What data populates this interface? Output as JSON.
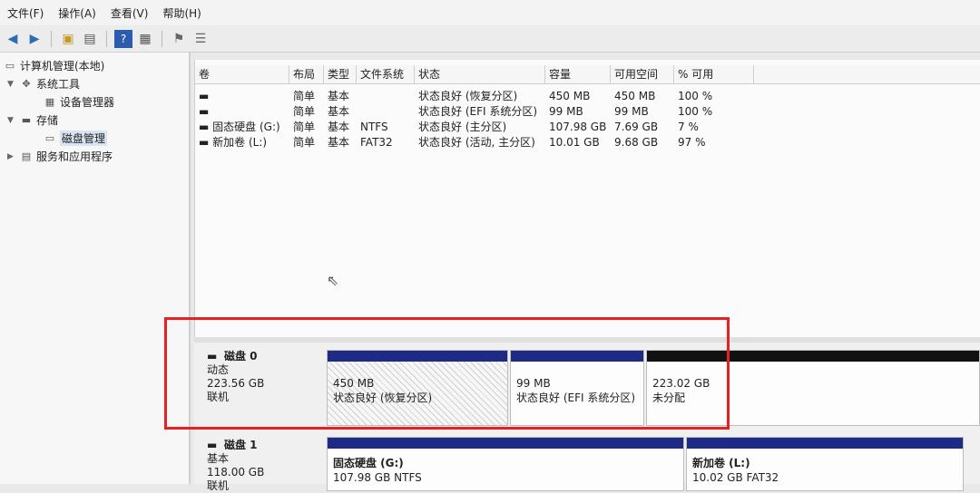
{
  "menubar": {
    "items": [
      "文件(F)",
      "操作(A)",
      "查看(V)",
      "帮助(H)"
    ]
  },
  "toolbar": {
    "icons": [
      "back-arrow-icon",
      "forward-arrow-icon",
      "up-folder-icon",
      "console-tree-icon",
      "help-icon",
      "properties-icon",
      "flag-icon",
      "list-view-icon"
    ]
  },
  "tree": {
    "root": "计算机管理(本地)",
    "system_tools": "系统工具",
    "device_manager": "设备管理器",
    "storage": "存储",
    "disk_management": "磁盘管理",
    "services": "服务和应用程序"
  },
  "volumes": {
    "columns": [
      "卷",
      "布局",
      "类型",
      "文件系统",
      "状态",
      "容量",
      "可用空间",
      "% 可用"
    ],
    "rows": [
      {
        "name": "",
        "layout": "简单",
        "type": "基本",
        "fs": "",
        "status": "状态良好 (恢复分区)",
        "capacity": "450 MB",
        "free": "450 MB",
        "pct": "100 %"
      },
      {
        "name": "",
        "layout": "简单",
        "type": "基本",
        "fs": "",
        "status": "状态良好 (EFI 系统分区)",
        "capacity": "99 MB",
        "free": "99 MB",
        "pct": "100 %"
      },
      {
        "name": "固态硬盘 (G:)",
        "layout": "简单",
        "type": "基本",
        "fs": "NTFS",
        "status": "状态良好 (主分区)",
        "capacity": "107.98 GB",
        "free": "7.69 GB",
        "pct": "7 %"
      },
      {
        "name": "新加卷 (L:)",
        "layout": "简单",
        "type": "基本",
        "fs": "FAT32",
        "status": "状态良好 (活动, 主分区)",
        "capacity": "10.01 GB",
        "free": "9.68 GB",
        "pct": "97 %"
      }
    ]
  },
  "disks": [
    {
      "name": "磁盘 0",
      "kind": "动态",
      "size": "223.56 GB",
      "state": "联机",
      "partitions": [
        {
          "title": "",
          "size": "450 MB",
          "status": "状态良好 (恢复分区)"
        },
        {
          "title": "",
          "size": "99 MB",
          "status": "状态良好 (EFI 系统分区)"
        },
        {
          "title": "",
          "size": "223.02 GB",
          "status": "未分配"
        }
      ]
    },
    {
      "name": "磁盘 1",
      "kind": "基本",
      "size": "118.00 GB",
      "state": "联机",
      "partitions": [
        {
          "title": "固态硬盘 (G:)",
          "size": "107.98 GB NTFS",
          "status": ""
        },
        {
          "title": "新加卷 (L:)",
          "size": "10.02 GB FAT32",
          "status": ""
        }
      ]
    }
  ]
}
